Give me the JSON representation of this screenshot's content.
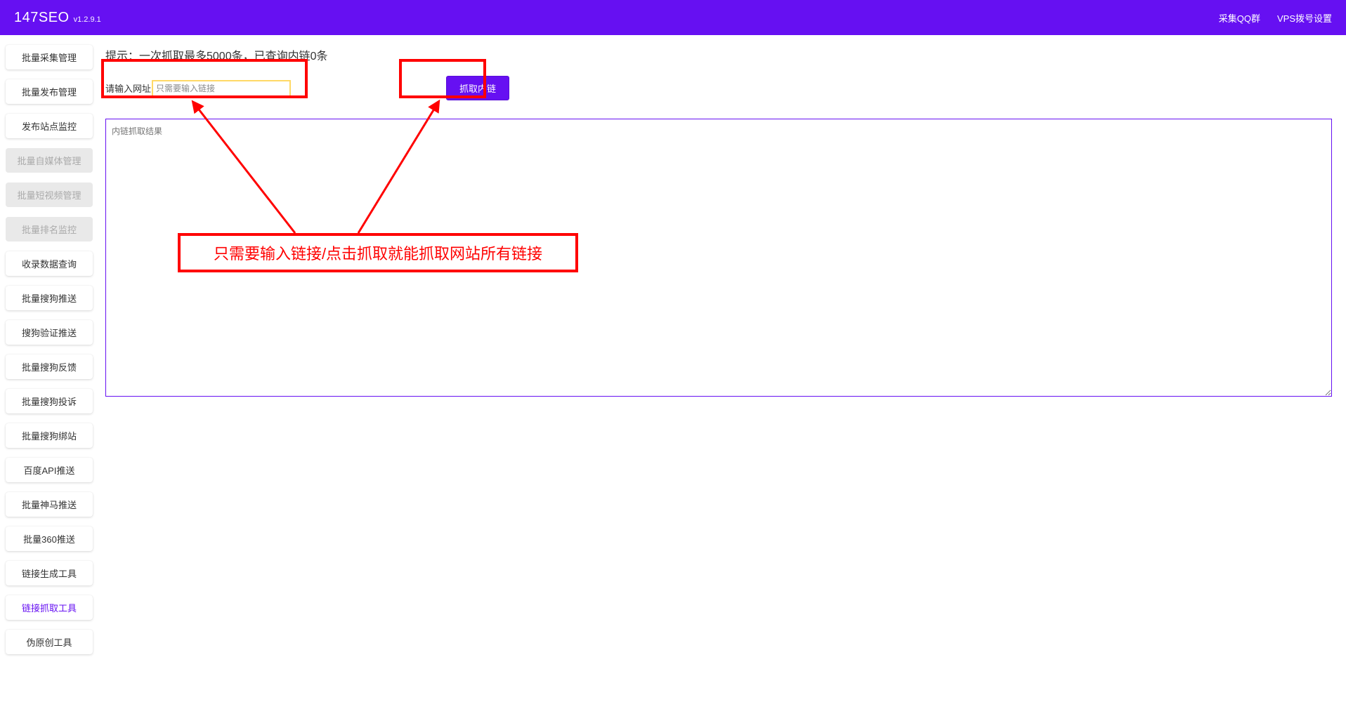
{
  "header": {
    "logo": "147SEO",
    "version": "v1.2.9.1",
    "links": {
      "qq_group": "采集QQ群",
      "vps_settings": "VPS拨号设置"
    }
  },
  "sidebar": {
    "items": [
      {
        "label": "批量采集管理",
        "disabled": false,
        "active": false
      },
      {
        "label": "批量发布管理",
        "disabled": false,
        "active": false
      },
      {
        "label": "发布站点监控",
        "disabled": false,
        "active": false
      },
      {
        "label": "批量自媒体管理",
        "disabled": true,
        "active": false
      },
      {
        "label": "批量短视频管理",
        "disabled": true,
        "active": false
      },
      {
        "label": "批量排名监控",
        "disabled": true,
        "active": false
      },
      {
        "label": "收录数据查询",
        "disabled": false,
        "active": false
      },
      {
        "label": "批量搜狗推送",
        "disabled": false,
        "active": false
      },
      {
        "label": "搜狗验证推送",
        "disabled": false,
        "active": false
      },
      {
        "label": "批量搜狗反馈",
        "disabled": false,
        "active": false
      },
      {
        "label": "批量搜狗投诉",
        "disabled": false,
        "active": false
      },
      {
        "label": "批量搜狗绑站",
        "disabled": false,
        "active": false
      },
      {
        "label": "百度API推送",
        "disabled": false,
        "active": false
      },
      {
        "label": "批量神马推送",
        "disabled": false,
        "active": false
      },
      {
        "label": "批量360推送",
        "disabled": false,
        "active": false
      },
      {
        "label": "链接生成工具",
        "disabled": false,
        "active": false
      },
      {
        "label": "链接抓取工具",
        "disabled": false,
        "active": true
      },
      {
        "label": "伪原创工具",
        "disabled": false,
        "active": false
      }
    ]
  },
  "main": {
    "hint": "提示：一次抓取最多5000条，已查询内链0条",
    "input_label": "请输入网址",
    "input_placeholder": "只需要输入链接",
    "fetch_button": "抓取内链",
    "result_placeholder": "内链抓取结果"
  },
  "annotations": {
    "instruction": "只需要输入链接/点击抓取就能抓取网站所有链接"
  }
}
